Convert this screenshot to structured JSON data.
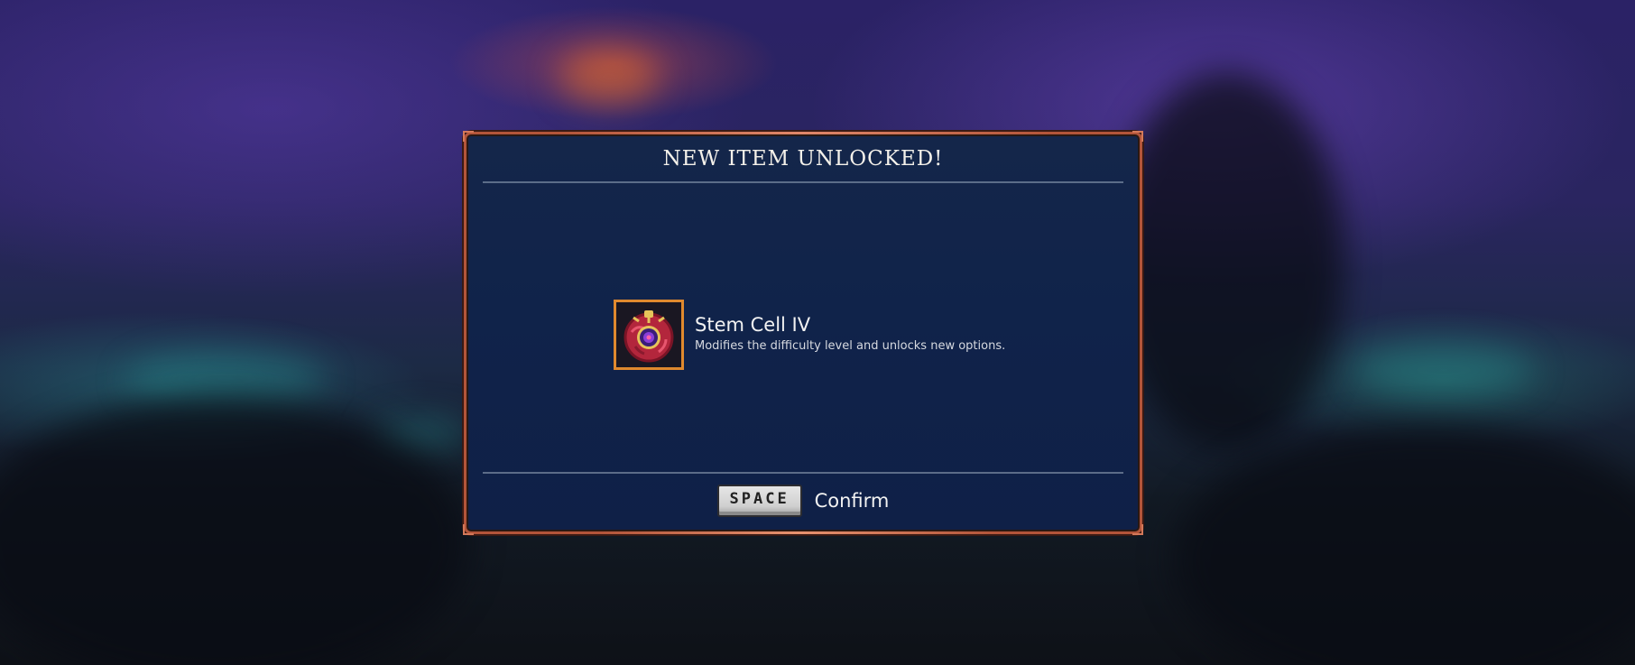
{
  "dialog": {
    "title": "NEW ITEM UNLOCKED!"
  },
  "item": {
    "name": "Stem Cell IV",
    "description": "Modifies the difficulty level and unlocks new options.",
    "icon": "stem-cell-icon"
  },
  "footer": {
    "key_label": "SPACE",
    "action_label": "Confirm"
  },
  "colors": {
    "frame_border": "#b3553a",
    "panel_background": "#10234a",
    "item_frame": "#e0892e"
  }
}
